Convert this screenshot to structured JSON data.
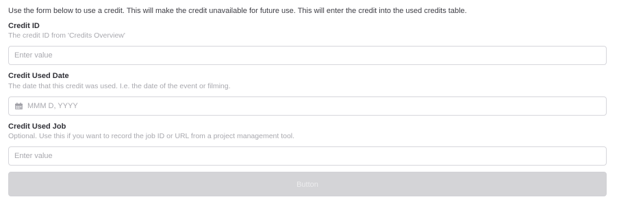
{
  "intro_text": "Use the form below to use a credit. This will make the credit unavailable for future use. This will enter the credit into the used credits table.",
  "fields": [
    {
      "label": "Credit ID",
      "help": "The credit ID from 'Credits Overview'",
      "value": "",
      "placeholder": "Enter value"
    },
    {
      "label": "Credit Used Date",
      "help": "The date that this credit was used. I.e. the date of the event or filming.",
      "value": "",
      "placeholder": "MMM D, YYYY",
      "icon": "calendar-icon"
    },
    {
      "label": "Credit Used Job",
      "help": "Optional. Use this if you want to record the job ID or URL from a project management tool.",
      "value": "",
      "placeholder": "Enter value"
    }
  ],
  "submit": {
    "label": "Button",
    "disabled": true
  },
  "colors": {
    "text": "#3d3d44",
    "help_text": "#a8a8ae",
    "input_border": "#d6d6db",
    "button_bg": "#d4d4d7",
    "button_text": "#ececee"
  }
}
